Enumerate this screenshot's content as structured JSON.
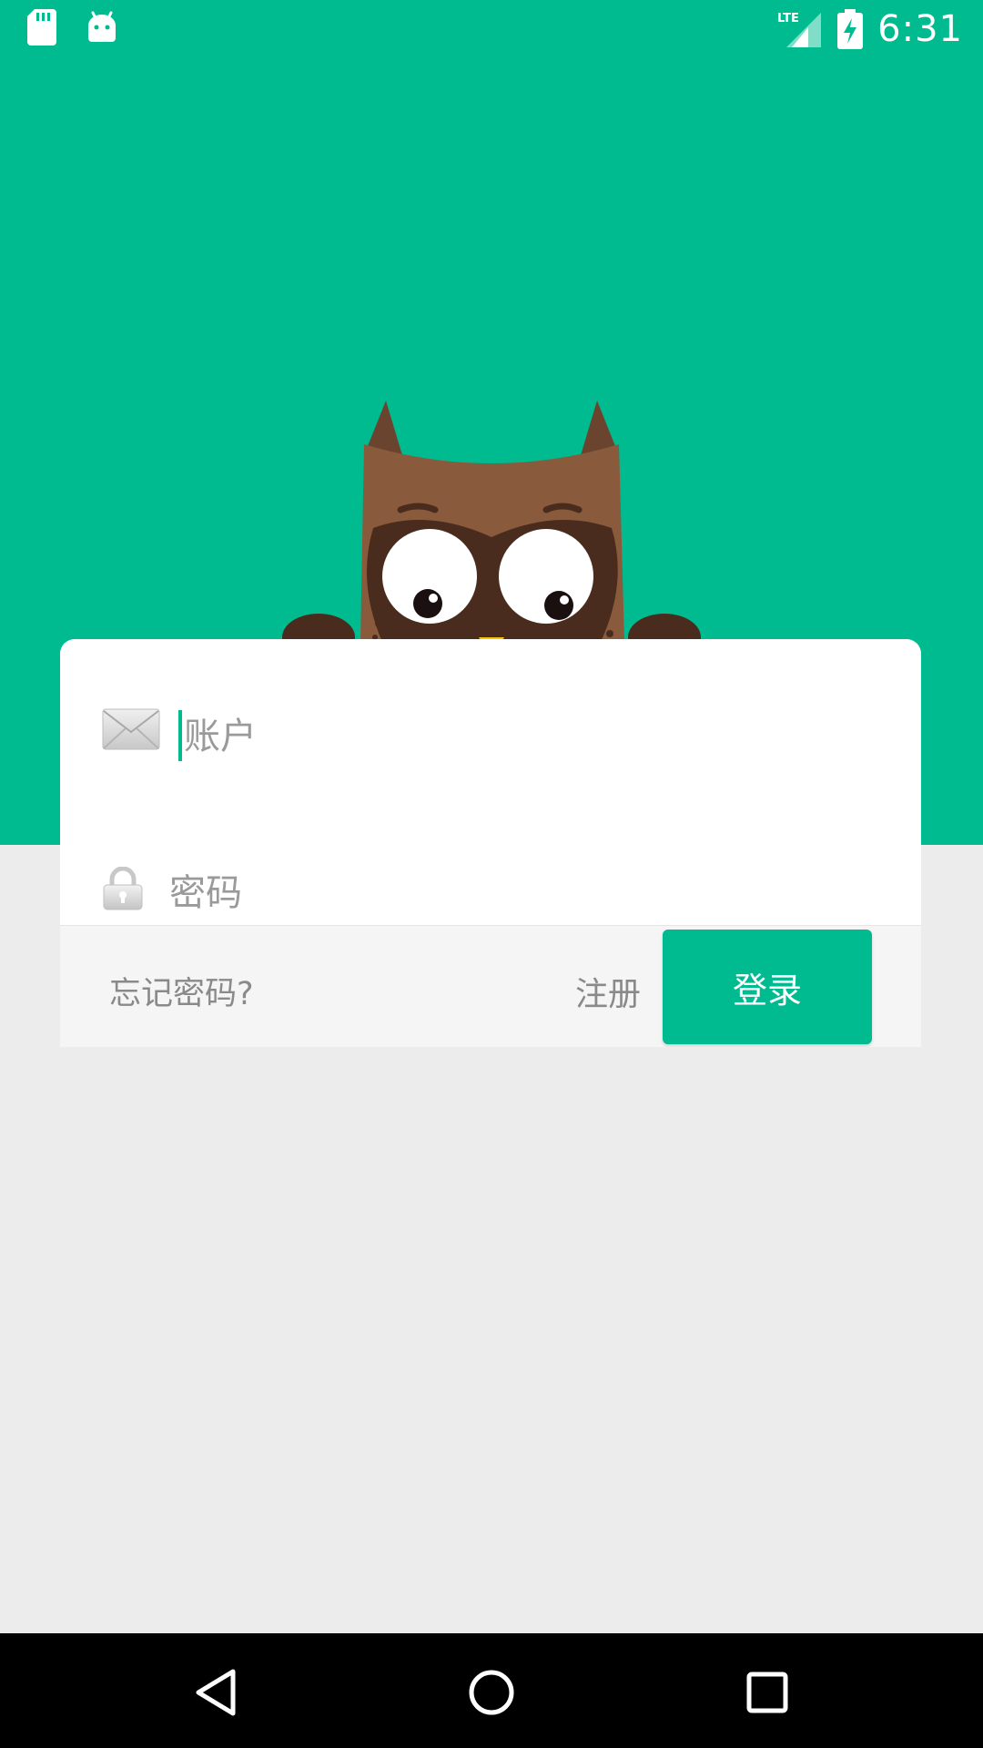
{
  "status_bar": {
    "time": "6:31",
    "network_label": "LTE",
    "left_icons": [
      "sd-card-icon",
      "android-icon"
    ],
    "right_icons": [
      "lte-signal-icon",
      "battery-charging-icon"
    ]
  },
  "login": {
    "account_placeholder": "账户",
    "password_placeholder": "密码",
    "forgot_password": "忘记密码?",
    "register": "注册",
    "login_button": "登录"
  },
  "nav_bar": {
    "buttons": [
      "back-icon",
      "home-icon",
      "recents-icon"
    ]
  },
  "colors": {
    "primary": "#00bb90",
    "background": "#ececec",
    "card": "#ffffff",
    "footer": "#f5f5f5",
    "owl_body": "#8a5a3c",
    "owl_dark": "#4a2c1e",
    "beak": "#ffc400"
  }
}
